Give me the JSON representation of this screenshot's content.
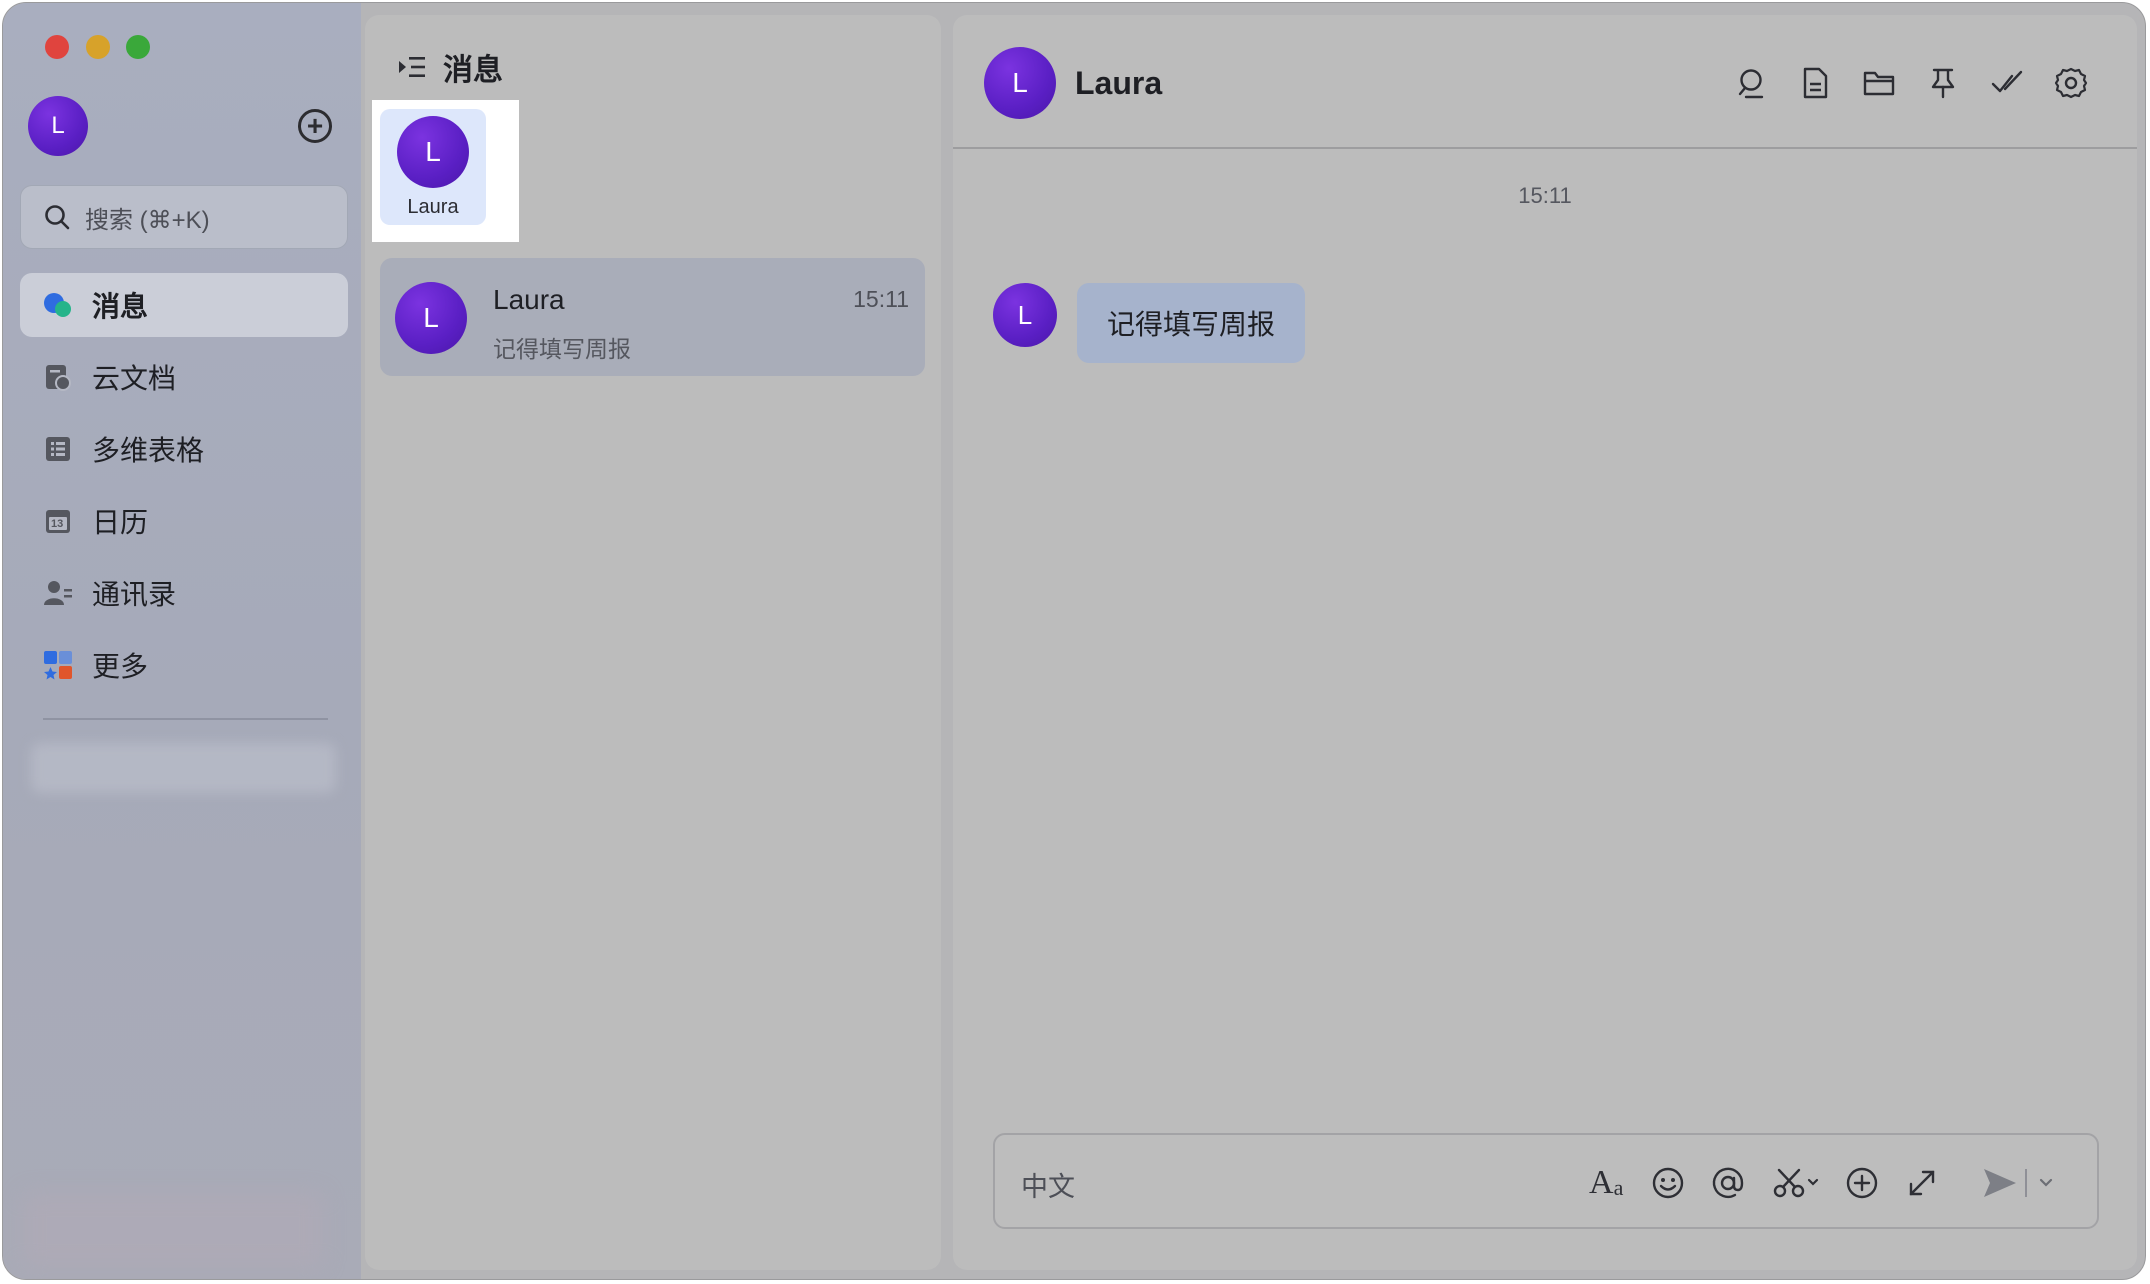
{
  "window": {
    "traffic_lights": [
      "close",
      "minimize",
      "zoom"
    ]
  },
  "sidebar": {
    "user_avatar_letter": "L",
    "add_icon": "plus-circle-icon",
    "search_placeholder": "搜索 (⌘+K)",
    "items": [
      {
        "label": "消息",
        "icon": "messages-icon",
        "active": true
      },
      {
        "label": "云文档",
        "icon": "cloud-docs-icon",
        "active": false
      },
      {
        "label": "多维表格",
        "icon": "base-table-icon",
        "active": false
      },
      {
        "label": "日历",
        "icon": "calendar-icon",
        "active": false,
        "icon_text": "13"
      },
      {
        "label": "通讯录",
        "icon": "contacts-icon",
        "active": false
      },
      {
        "label": "更多",
        "icon": "more-apps-icon",
        "active": false
      }
    ]
  },
  "conversation_list": {
    "title": "消息",
    "story": {
      "avatar_letter": "L",
      "name": "Laura"
    },
    "items": [
      {
        "avatar_letter": "L",
        "name": "Laura",
        "time": "15:11",
        "preview": "记得填写周报"
      }
    ]
  },
  "chat": {
    "avatar_letter": "L",
    "title": "Laura",
    "toolbar_icons": [
      "search-icon",
      "document-icon",
      "folder-icon",
      "pin-icon",
      "check-mark-icon",
      "settings-icon"
    ],
    "timestamp": "15:11",
    "messages": [
      {
        "avatar_letter": "L",
        "text": "记得填写周报"
      }
    ],
    "composer": {
      "placeholder": "中文",
      "tools": [
        "text-format-icon",
        "emoji-icon",
        "mention-icon",
        "screenshot-scissors-icon",
        "add-icon",
        "expand-icon",
        "send-icon",
        "send-options-chevron-icon"
      ]
    }
  },
  "colors": {
    "accent_purple": "#5a1fc4",
    "bubble": "#a6b3cc",
    "active_item": "#d7dae2"
  }
}
